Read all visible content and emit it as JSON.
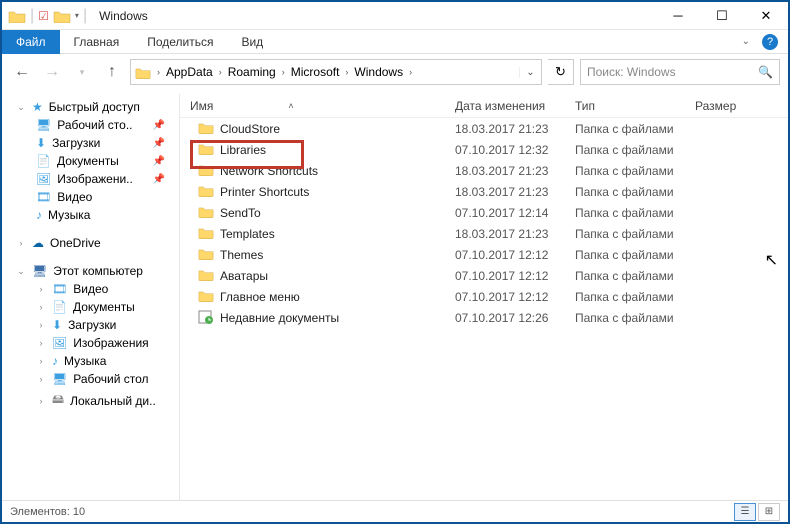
{
  "window": {
    "title": "Windows"
  },
  "ribbon": {
    "file": "Файл",
    "tabs": [
      "Главная",
      "Поделиться",
      "Вид"
    ]
  },
  "breadcrumb": [
    "AppData",
    "Roaming",
    "Microsoft",
    "Windows"
  ],
  "search": {
    "placeholder": "Поиск: Windows"
  },
  "columns": {
    "name": "Имя",
    "date": "Дата изменения",
    "type": "Тип",
    "size": "Размер"
  },
  "files": [
    {
      "name": "CloudStore",
      "date": "18.03.2017 21:23",
      "type": "Папка с файлами",
      "icon": "folder"
    },
    {
      "name": "Libraries",
      "date": "07.10.2017 12:32",
      "type": "Папка с файлами",
      "icon": "folder",
      "highlight": true
    },
    {
      "name": "Network Shortcuts",
      "date": "18.03.2017 21:23",
      "type": "Папка с файлами",
      "icon": "folder"
    },
    {
      "name": "Printer Shortcuts",
      "date": "18.03.2017 21:23",
      "type": "Папка с файлами",
      "icon": "folder"
    },
    {
      "name": "SendTo",
      "date": "07.10.2017 12:14",
      "type": "Папка с файлами",
      "icon": "folder"
    },
    {
      "name": "Templates",
      "date": "18.03.2017 21:23",
      "type": "Папка с файлами",
      "icon": "folder"
    },
    {
      "name": "Themes",
      "date": "07.10.2017 12:12",
      "type": "Папка с файлами",
      "icon": "folder"
    },
    {
      "name": "Аватары",
      "date": "07.10.2017 12:12",
      "type": "Папка с файлами",
      "icon": "folder"
    },
    {
      "name": "Главное меню",
      "date": "07.10.2017 12:12",
      "type": "Папка с файлами",
      "icon": "folder"
    },
    {
      "name": "Недавние документы",
      "date": "07.10.2017 12:26",
      "type": "Папка с файлами",
      "icon": "recent"
    }
  ],
  "sidebar": {
    "quick": {
      "label": "Быстрый доступ",
      "items": [
        {
          "label": "Рабочий сто..",
          "icon": "desktop",
          "pinned": true
        },
        {
          "label": "Загрузки",
          "icon": "downloads",
          "pinned": true
        },
        {
          "label": "Документы",
          "icon": "documents",
          "pinned": true
        },
        {
          "label": "Изображени..",
          "icon": "pictures",
          "pinned": true
        },
        {
          "label": "Видео",
          "icon": "videos"
        },
        {
          "label": "Музыка",
          "icon": "music"
        }
      ]
    },
    "onedrive": {
      "label": "OneDrive"
    },
    "thispc": {
      "label": "Этот компьютер",
      "items": [
        {
          "label": "Видео",
          "icon": "videos"
        },
        {
          "label": "Документы",
          "icon": "documents"
        },
        {
          "label": "Загрузки",
          "icon": "downloads"
        },
        {
          "label": "Изображения",
          "icon": "pictures"
        },
        {
          "label": "Музыка",
          "icon": "music"
        },
        {
          "label": "Рабочий стол",
          "icon": "desktop"
        },
        {
          "label": "Локальный ди..",
          "icon": "disk"
        }
      ]
    }
  },
  "status": {
    "count_label": "Элементов: 10"
  }
}
